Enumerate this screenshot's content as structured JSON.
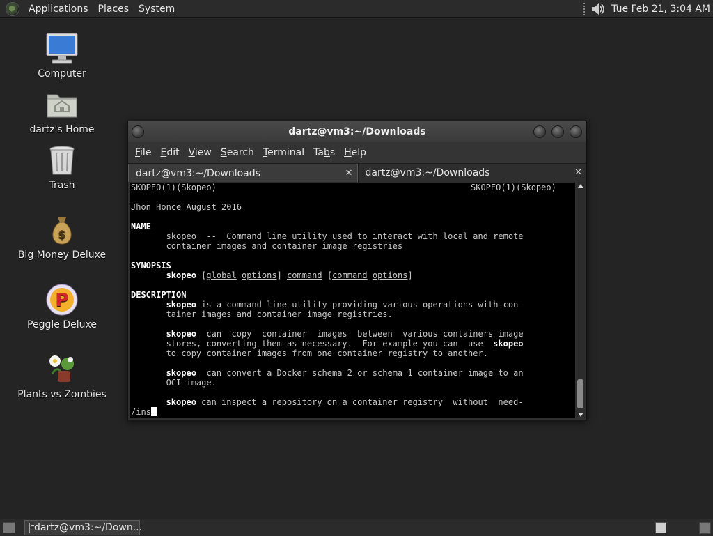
{
  "top_panel": {
    "menus": [
      "Applications",
      "Places",
      "System"
    ],
    "clock": "Tue Feb 21,  3:04 AM"
  },
  "desktop_icons": [
    {
      "label": "Computer",
      "icon": "computer-icon"
    },
    {
      "label": "dartz's Home",
      "icon": "home-folder-icon"
    },
    {
      "label": "Trash",
      "icon": "trash-icon"
    },
    {
      "label": "Big Money Deluxe",
      "icon": "money-bag-icon"
    },
    {
      "label": "Peggle Deluxe",
      "icon": "peggle-icon"
    },
    {
      "label": "Plants vs Zombies",
      "icon": "plants-icon"
    }
  ],
  "window": {
    "title": "dartz@vm3:~/Downloads",
    "menu": [
      {
        "pre": "",
        "key": "F",
        "post": "ile"
      },
      {
        "pre": "",
        "key": "E",
        "post": "dit"
      },
      {
        "pre": "",
        "key": "V",
        "post": "iew"
      },
      {
        "pre": "",
        "key": "S",
        "post": "earch"
      },
      {
        "pre": "",
        "key": "T",
        "post": "erminal"
      },
      {
        "pre": "Ta",
        "key": "b",
        "post": "s"
      },
      {
        "pre": "",
        "key": "H",
        "post": "elp"
      }
    ],
    "tabs": [
      {
        "label": "dartz@vm3:~/Downloads",
        "active": true
      },
      {
        "label": "dartz@vm3:~/Downloads",
        "active": false
      }
    ],
    "close_glyph": "✕"
  },
  "terminal": {
    "header_left": "SKOPEO(1)(Skopeo)",
    "header_right": "SKOPEO(1)(Skopeo)",
    "author": "Jhon Honce August 2016",
    "name_heading": "NAME",
    "name_line1": "       skopeo  --  Command line utility used to interact with local and remote",
    "name_line2": "       container images and container image registries",
    "synopsis_heading": "SYNOPSIS",
    "syn_cmd": "skopeo",
    "syn_global": "global",
    "syn_options": "options",
    "syn_command": "command",
    "syn_command2": "command",
    "syn_options2": "options",
    "description_heading": "DESCRIPTION",
    "desc1_rest": " is a command line utility providing various operations with con-",
    "desc1_line2": "       tainer images and container image registries.",
    "desc2_rest": "  can  copy  container  images  between  various containers image",
    "desc2_line2a": "       stores, converting them as necessary.  For example you can  use  ",
    "desc2_line3": "       to copy container images from one container registry to another.",
    "desc3_rest": "  can convert a Docker schema 2 or schema 1 container image to an",
    "desc3_line2": "       OCI image.",
    "desc4_rest": " can inspect a repository on a container registry  without  need-",
    "prompt": "/ins"
  },
  "taskbar": {
    "task_label": "dartz@vm3:~/Down..."
  }
}
